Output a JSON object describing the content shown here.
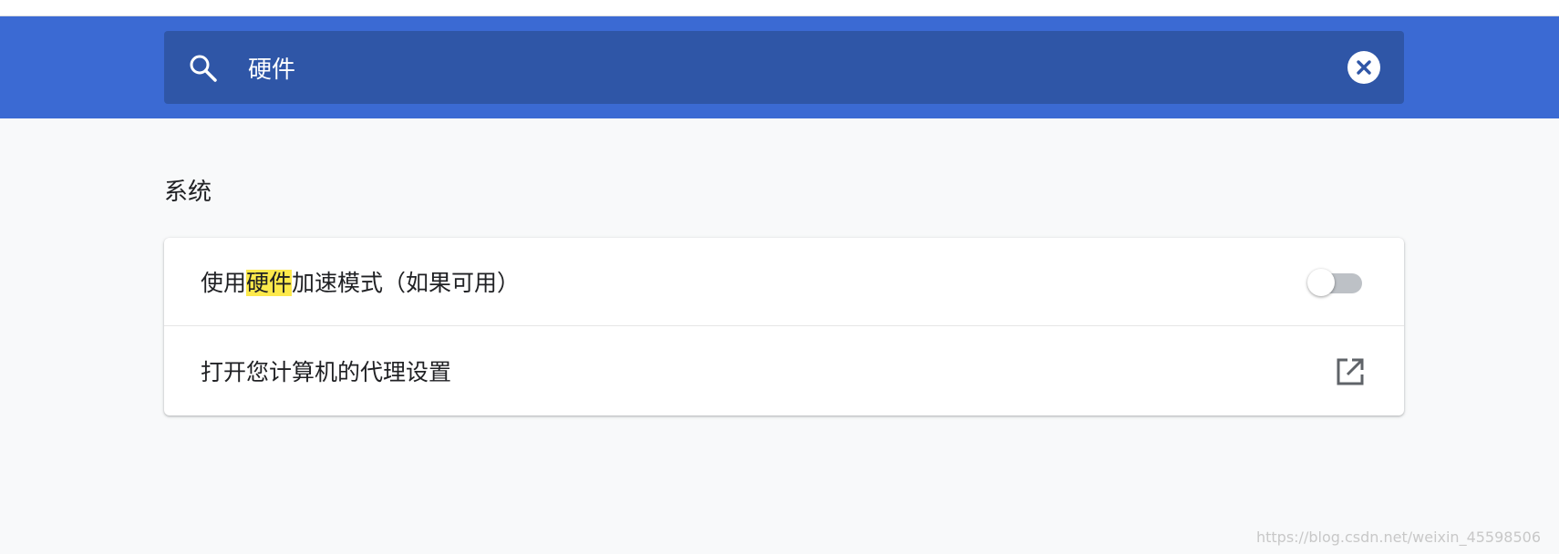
{
  "search": {
    "value": "硬件",
    "icon": "search-icon",
    "clear_icon": "close-icon"
  },
  "section": {
    "title": "系统"
  },
  "settings": {
    "rows": [
      {
        "label_before": "使用",
        "label_highlight": "硬件",
        "label_after": "加速模式（如果可用）",
        "control": "toggle",
        "enabled": false
      },
      {
        "label": "打开您计算机的代理设置",
        "control": "external-link-icon"
      }
    ]
  },
  "watermark": "https://blog.csdn.net/weixin_45598506",
  "colors": {
    "header": "#3b6ad3",
    "search_box": "#2f56a7",
    "background": "#f8f9fa",
    "highlight": "#fde94b",
    "toggle_off": "#bdc1c6"
  }
}
